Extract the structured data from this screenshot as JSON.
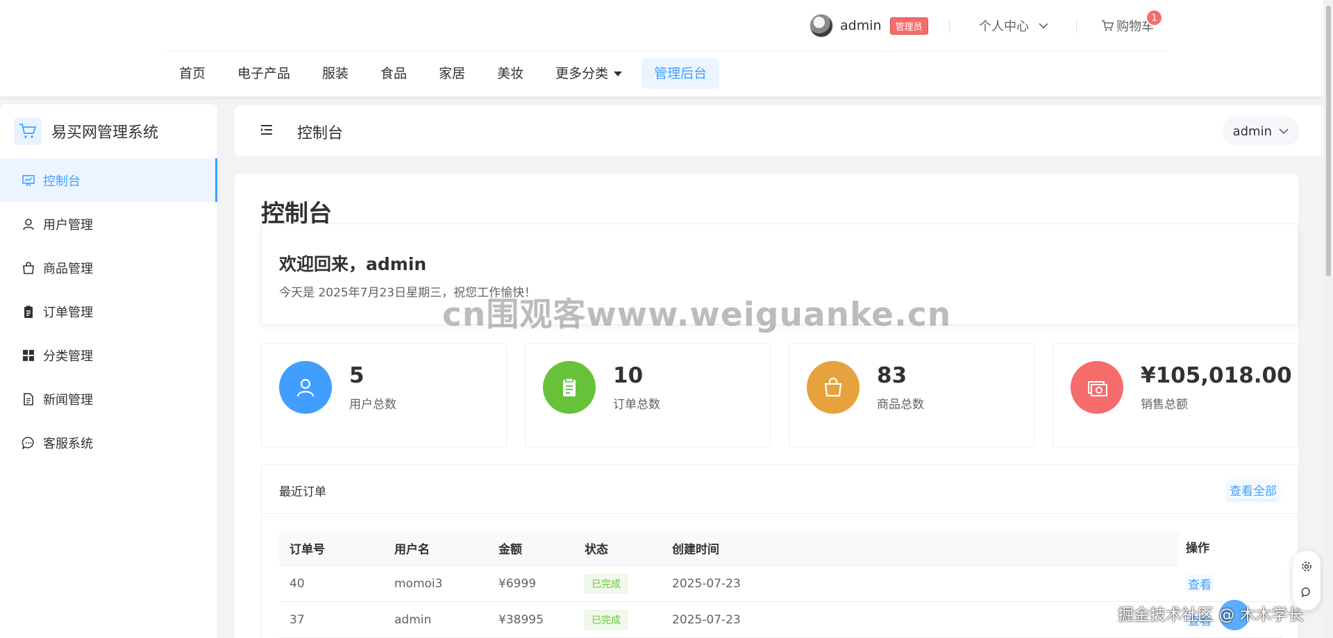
{
  "header": {
    "username": "admin",
    "role_badge": "管理员",
    "personal_center": "个人中心",
    "cart_label": "购物车",
    "cart_count": "1",
    "nav": [
      {
        "label": "首页"
      },
      {
        "label": "电子产品"
      },
      {
        "label": "服装"
      },
      {
        "label": "食品"
      },
      {
        "label": "家居"
      },
      {
        "label": "美妆"
      },
      {
        "label": "更多分类"
      },
      {
        "label": "管理后台"
      }
    ]
  },
  "sidebar": {
    "brand": "易买网管理系统",
    "items": [
      {
        "label": "控制台",
        "icon": "dashboard-icon"
      },
      {
        "label": "用户管理",
        "icon": "user-icon"
      },
      {
        "label": "商品管理",
        "icon": "shopping-bag-icon"
      },
      {
        "label": "订单管理",
        "icon": "clipboard-icon"
      },
      {
        "label": "分类管理",
        "icon": "grid-icon"
      },
      {
        "label": "新闻管理",
        "icon": "document-icon"
      },
      {
        "label": "客服系统",
        "icon": "chat-icon"
      }
    ]
  },
  "pagebar": {
    "title": "控制台",
    "user": "admin"
  },
  "main": {
    "heading": "控制台",
    "welcome_title": "欢迎回来，admin",
    "welcome_sub": "今天是 2025年7月23日星期三，祝您工作愉快！",
    "stats": [
      {
        "value": "5",
        "label": "用户总数",
        "color": "#409eff",
        "icon": "user-icon"
      },
      {
        "value": "10",
        "label": "订单总数",
        "color": "#67c23a",
        "icon": "clipboard-icon"
      },
      {
        "value": "83",
        "label": "商品总数",
        "color": "#e6a23c",
        "icon": "shopping-bag-icon"
      },
      {
        "value": "¥105,018.00",
        "label": "销售总额",
        "color": "#f56c6c",
        "icon": "money-icon"
      }
    ],
    "orders": {
      "title": "最近订单",
      "view_all": "查看全部",
      "columns": [
        "订单号",
        "用户名",
        "金额",
        "状态",
        "创建时间",
        "操作"
      ],
      "rows": [
        {
          "id": "40",
          "user": "momoi3",
          "amount": "¥6999",
          "status": "已完成",
          "date": "2025-07-23",
          "action": "查看"
        },
        {
          "id": "37",
          "user": "admin",
          "amount": "¥38995",
          "status": "已完成",
          "date": "2025-07-23",
          "action": "查看"
        }
      ]
    }
  },
  "overlay": {
    "watermark": "cn围观客www.weiguanke.cn",
    "corner": "掘金技术社区 @ 木木学长"
  },
  "colors": {
    "accent": "#409eff",
    "success": "#67c23a",
    "warning": "#e6a23c",
    "danger": "#f56c6c"
  }
}
